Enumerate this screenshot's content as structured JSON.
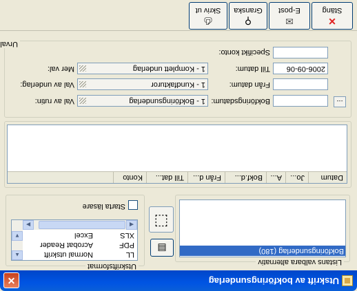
{
  "window": {
    "title": "Utskrift av bokföringsunderlag",
    "close_glyph": "✕",
    "icon": "document-icon"
  },
  "print_list": {
    "group_label": "Listans valbara alternativ",
    "items": [
      "Bokföringsunderlag (180)"
    ],
    "selected_index": 0
  },
  "output_format": {
    "group_label": "Utskriftsformat",
    "options": [
      {
        "code": "LL",
        "name": "Normal utskrift"
      },
      {
        "code": "PDF",
        "name": "Acrobat Reader"
      },
      {
        "code": "XLS",
        "name": "Excel"
      }
    ],
    "checkbox_label": "Starta läsare",
    "checkbox_checked": false
  },
  "results": {
    "group_label": "Urval",
    "columns": [
      "Datum",
      "Jo...",
      "A...",
      "Bokf.d...",
      "Från d...",
      "Till dat...",
      "Konto"
    ]
  },
  "filters": {
    "left": [
      {
        "label": "Val av rutin:",
        "value": "1 - Bokföringsunderlag"
      },
      {
        "label": "Val av underlag:",
        "value": "1 - Kundfakturor"
      },
      {
        "label": "Mer val:",
        "value": "1 - Komplett underlag"
      }
    ],
    "right": [
      {
        "label": "Bokföringsdatum:",
        "value": ""
      },
      {
        "label": "Från datum:",
        "value": ""
      },
      {
        "label": "Till datum:",
        "value": "2006-09-06"
      },
      {
        "label": "Specifikt konto:",
        "value": ""
      }
    ],
    "browse_label": "..."
  },
  "toolbar": {
    "buttons": [
      {
        "label": "Stäng",
        "icon": "close-icon",
        "glyph": "✕",
        "color": "#e02020"
      },
      {
        "label": "E-post",
        "icon": "email-icon",
        "glyph": "✉",
        "color": "#4a4a4a"
      },
      {
        "label": "Granska",
        "icon": "magnifier-icon",
        "glyph": "⚲",
        "color": "#303030"
      },
      {
        "label": "Skriv ut",
        "icon": "printer-icon",
        "glyph": "⎙",
        "color": "#303030"
      }
    ]
  },
  "colors": {
    "titlebar": "#0054e3",
    "selection": "#316ac5",
    "window_bg": "#ece9d8"
  }
}
